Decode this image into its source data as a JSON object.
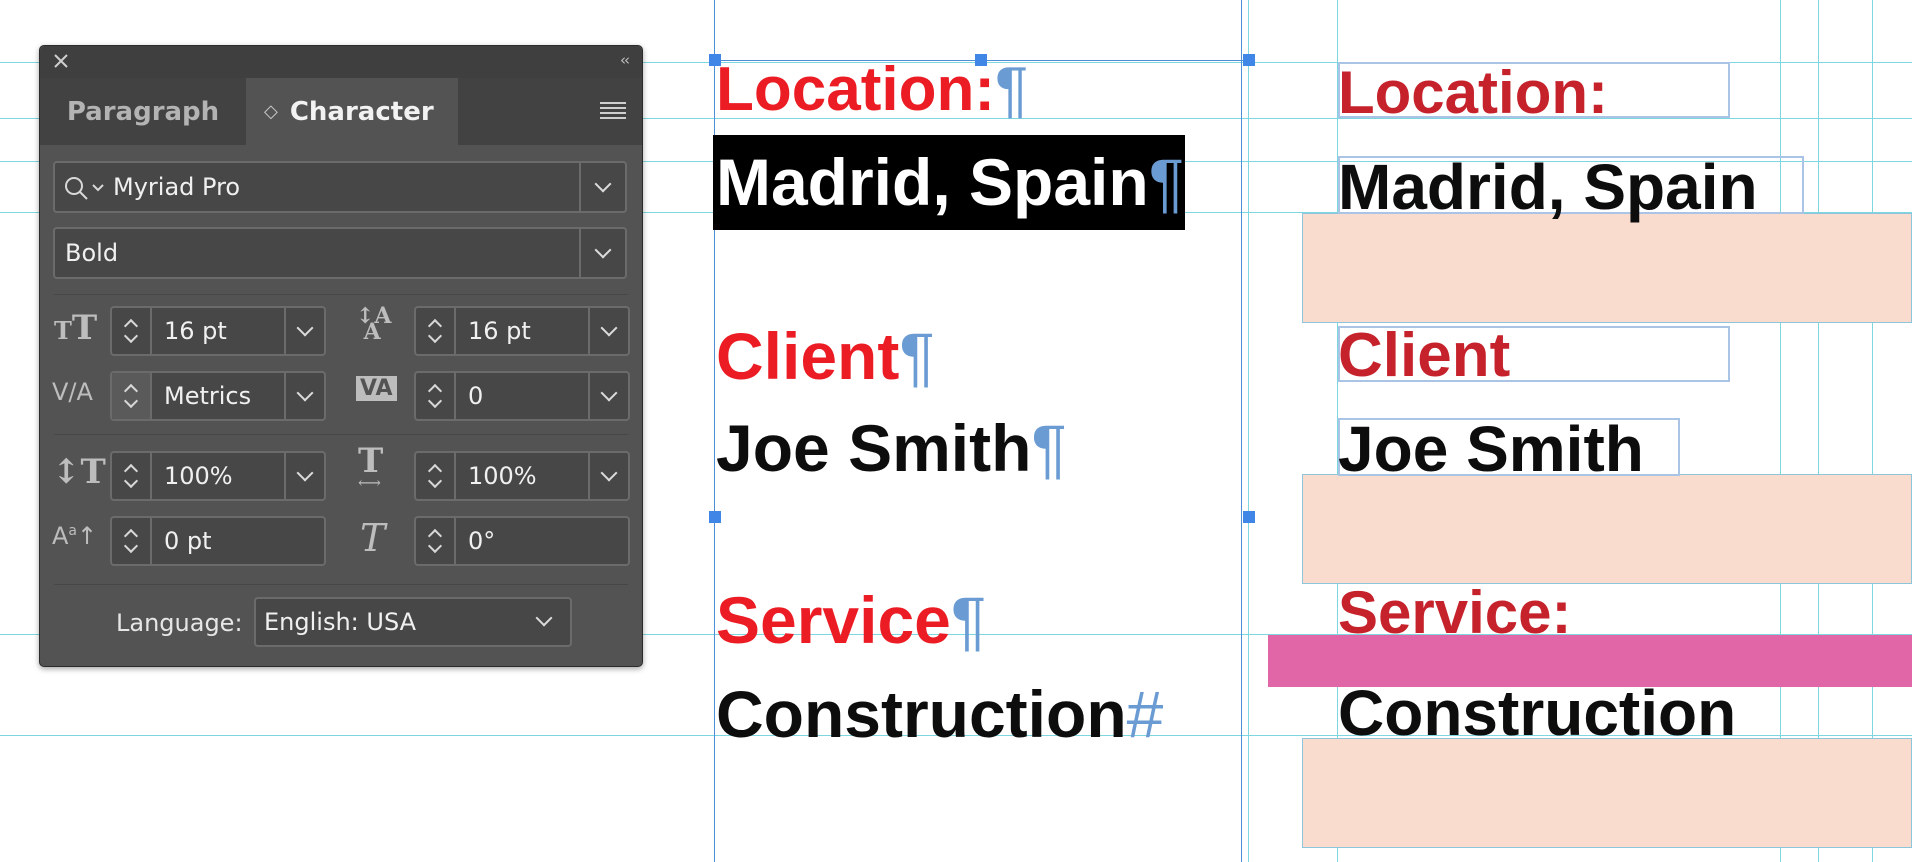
{
  "panel": {
    "tabs": [
      "Paragraph",
      "Character"
    ],
    "font_family": "Myriad Pro",
    "font_style": "Bold",
    "font_size": "16 pt",
    "leading": "16 pt",
    "kerning": "Metrics",
    "tracking": "0",
    "vertical_scale": "100%",
    "horizontal_scale": "100%",
    "baseline_shift": "0 pt",
    "skew": "0°",
    "language_label": "Language:",
    "language_value": "English: USA",
    "icons": {
      "font_size": "TT",
      "leading": "A",
      "kerning": "V/A",
      "tracking": "VA",
      "vertical_scale": "IT",
      "horizontal_scale": "T",
      "baseline_shift": "Aa",
      "skew": "T"
    }
  },
  "document": {
    "location_label": "Location:",
    "location_value": "Madrid, Spain",
    "client_label": "Client",
    "client_value": "Joe Smith",
    "service_label": "Service",
    "service_value": "Construction",
    "pilcrow": "¶",
    "end_mark": "#"
  },
  "preview": {
    "location_label": "Location:",
    "location_value": "Madrid, Spain",
    "client_label": "Client",
    "client_value": "Joe Smith",
    "service_label": "Service:",
    "service_value": "Construction"
  },
  "colors": {
    "label_red": "#ec1c24",
    "panel_bg": "#535353",
    "guide": "#7ed6de",
    "selection": "#3f86e6"
  }
}
